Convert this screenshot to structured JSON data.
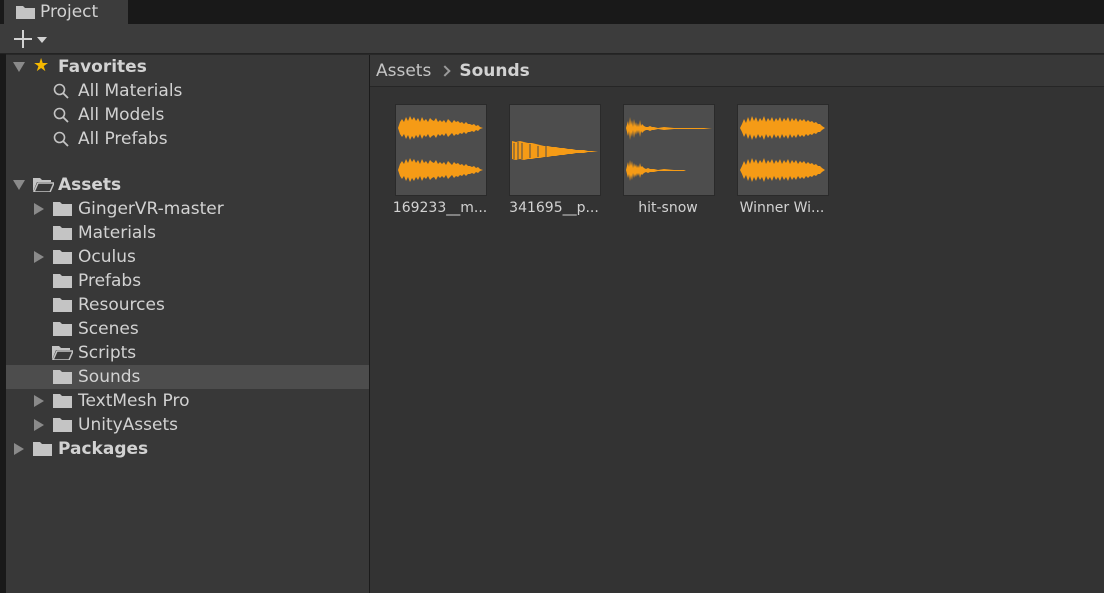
{
  "window": {
    "tab_label": "Project",
    "tab_icon": "folder-icon"
  },
  "toolbar": {
    "add_icon": "plus-icon",
    "dropdown_icon": "caret-down-icon"
  },
  "colors": {
    "waveform": "#f59b16",
    "folder": "#c4c4c4",
    "star": "#f5b800",
    "selection": "#4d4d4d"
  },
  "tree": {
    "favorites": {
      "label": "Favorites",
      "icon": "star-icon",
      "items": [
        {
          "label": "All Materials",
          "icon": "search-icon"
        },
        {
          "label": "All Models",
          "icon": "search-icon"
        },
        {
          "label": "All Prefabs",
          "icon": "search-icon"
        }
      ]
    },
    "assets": {
      "label": "Assets",
      "icon": "folder-open-icon",
      "items": [
        {
          "label": "GingerVR-master",
          "expandable": true
        },
        {
          "label": "Materials",
          "expandable": false
        },
        {
          "label": "Oculus",
          "expandable": true
        },
        {
          "label": "Prefabs",
          "expandable": false
        },
        {
          "label": "Resources",
          "expandable": false
        },
        {
          "label": "Scenes",
          "expandable": false
        },
        {
          "label": "Scripts",
          "expandable": false
        },
        {
          "label": "Sounds",
          "expandable": false,
          "selected": true
        },
        {
          "label": "TextMesh Pro",
          "expandable": true
        },
        {
          "label": "UnityAssets",
          "expandable": true
        }
      ]
    },
    "packages": {
      "label": "Packages",
      "icon": "folder-icon"
    }
  },
  "breadcrumb": {
    "root": "Assets",
    "current": "Sounds"
  },
  "assets_grid": [
    {
      "label": "169233__m...",
      "icon": "audio-waveform-icon"
    },
    {
      "label": "341695__p...",
      "icon": "audio-waveform-icon"
    },
    {
      "label": "hit-snow",
      "icon": "audio-waveform-icon"
    },
    {
      "label": "Winner Wi...",
      "icon": "audio-waveform-icon"
    }
  ]
}
